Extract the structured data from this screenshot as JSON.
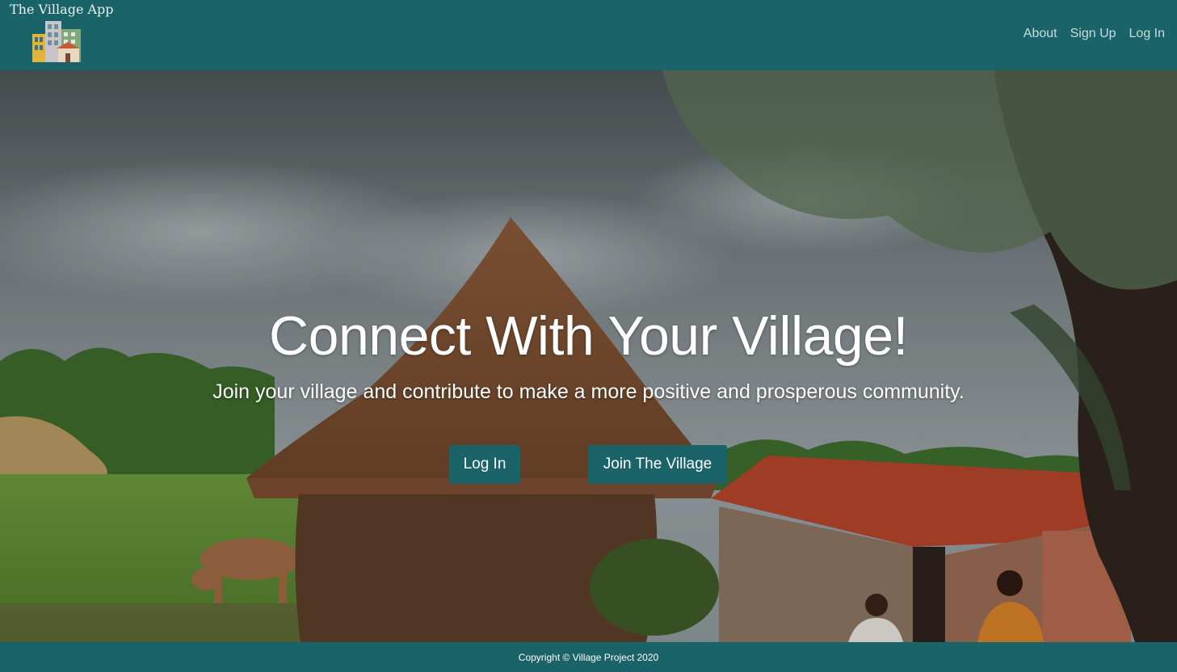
{
  "navbar": {
    "brand": "The Village App",
    "logo_icon": "village-buildings-icon",
    "links": [
      "About",
      "Sign Up",
      "Log In"
    ]
  },
  "hero": {
    "title": "Connect With Your Village!",
    "subtitle": "Join your village and contribute to make a more positive and prosperous community.",
    "buttons": {
      "login": "Log In",
      "join": "Join The Village"
    }
  },
  "footer": {
    "copyright": "Copyright © Village Project 2020"
  },
  "colors": {
    "primary": "#1a6368",
    "nav_link": "#c9dcdb",
    "text": "#ffffff"
  }
}
